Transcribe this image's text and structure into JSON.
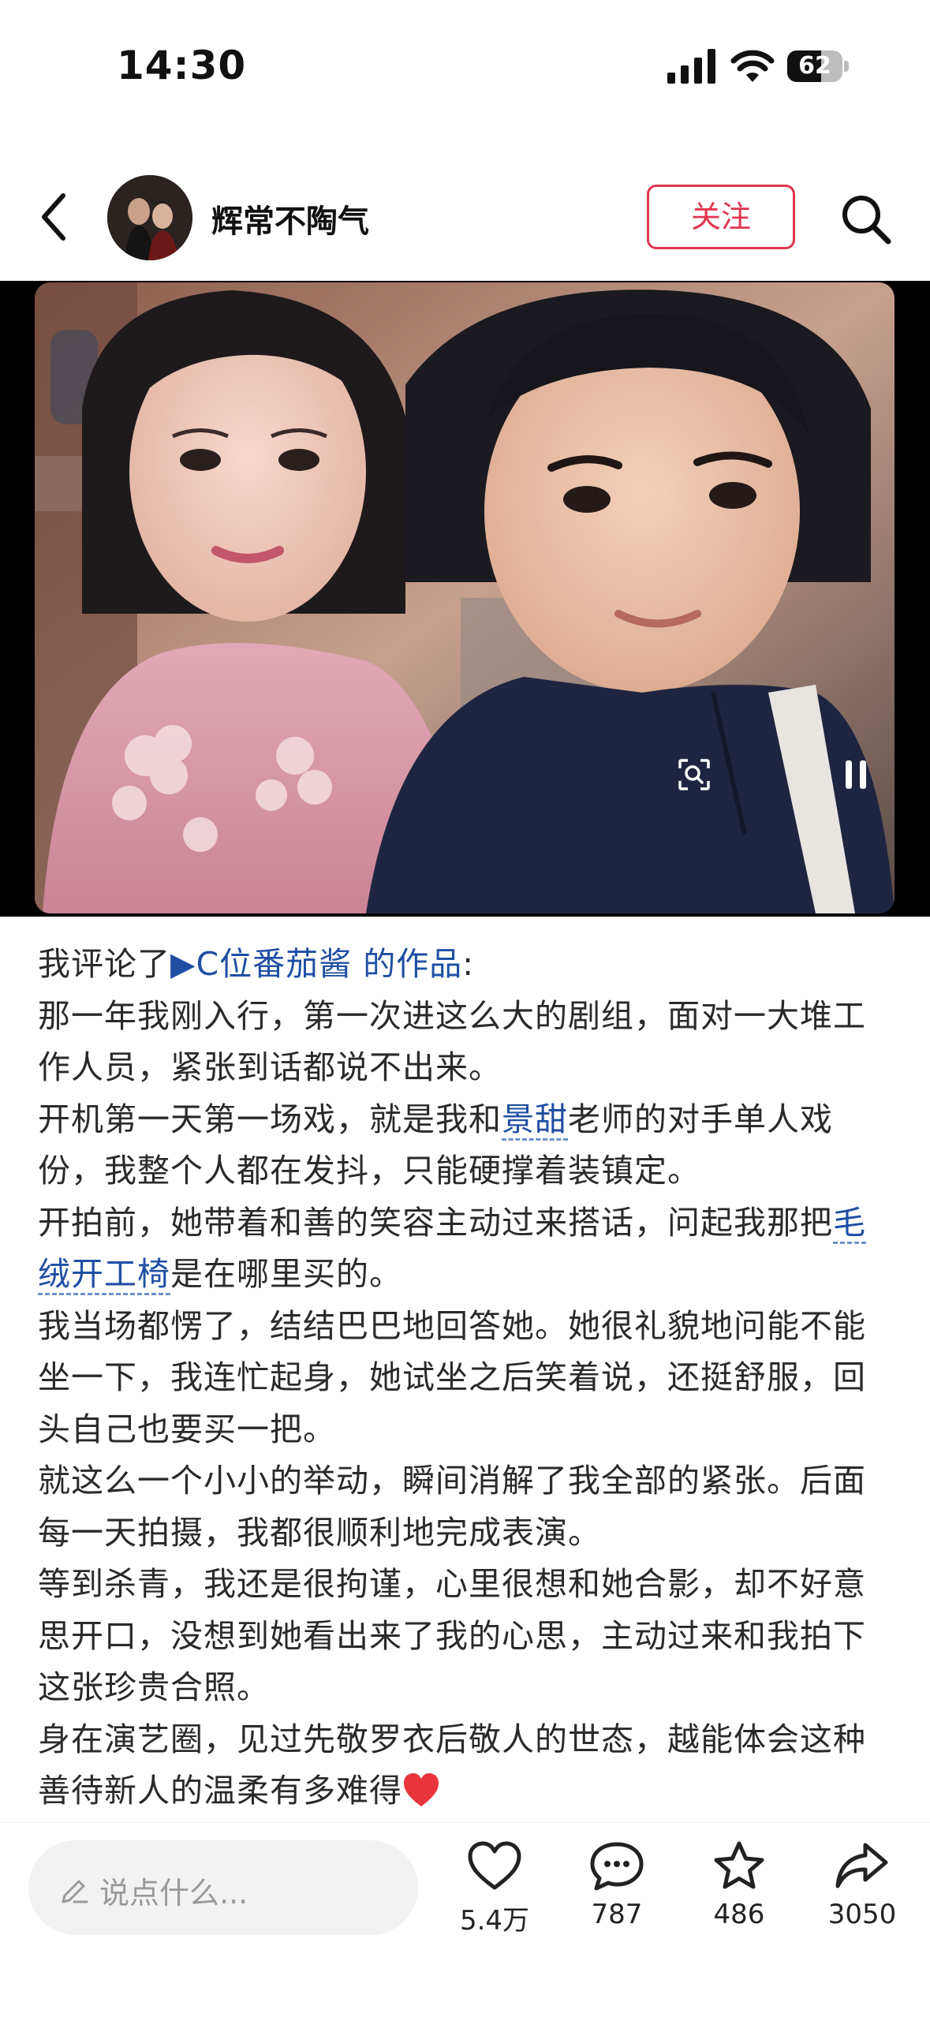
{
  "status_bar": {
    "time": "14:30",
    "battery": "62",
    "battery_level": 0.62
  },
  "header": {
    "username": "辉常不陶气",
    "follow_label": "关注"
  },
  "post": {
    "intro_prefix": "我评论了",
    "intro_link": "C位番茄酱 的作品",
    "intro_suffix": ":",
    "p1": "那一年我刚入行，第一次进这么大的剧组，面对一大堆工作人员，紧张到话都说不出来。",
    "p2_a": "开机第一天第一场戏，就是我和",
    "p2_link": "景甜",
    "p2_b": "老师的对手单人戏份，我整个人都在发抖，只能硬撑着装镇定。",
    "p3_a": "开拍前，她带着和善的笑容主动过来搭话，问起我那把",
    "p3_link": "毛绒开工椅",
    "p3_b": "是在哪里买的。",
    "p4": "我当场都愣了，结结巴巴地回答她。她很礼貌地问能不能坐一下，我连忙起身，她试坐之后笑着说，还挺舒服，回头自己也要买一把。",
    "p5": "就这么一个小小的举动，瞬间消解了我全部的紧张。后面每一天拍摄，我都很顺利地完成表演。",
    "p6": "等到杀青，我还是很拘谨，心里很想和她合影，却不好意思开口，没想到她看出来了我的心思，主动过来和我拍下这张珍贵合照。",
    "p7": "身在演艺圈，见过先敬罗衣后敬人的世态，越能体会这种善待新人的温柔有多难得"
  },
  "bottom_bar": {
    "comment_placeholder": "说点什么...",
    "likes": "5.4万",
    "comments": "787",
    "favorites": "486",
    "shares": "3050"
  },
  "colors": {
    "accent": "#e0364f",
    "link": "#1f4fa3"
  }
}
